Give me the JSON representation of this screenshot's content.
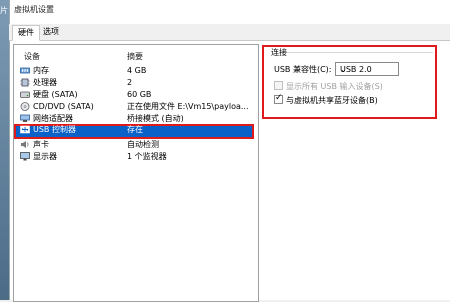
{
  "desktop_fragment": "片",
  "window": {
    "title": "虚拟机设置"
  },
  "tabs": [
    {
      "label": "硬件"
    },
    {
      "label": "选项"
    }
  ],
  "device_table": {
    "headers": {
      "device": "设备",
      "summary": "摘要"
    },
    "rows": [
      {
        "label": "内存",
        "value": "4 GB",
        "icon": "memory-icon"
      },
      {
        "label": "处理器",
        "value": "2",
        "icon": "processor-icon"
      },
      {
        "label": "硬盘 (SATA)",
        "value": "60 GB",
        "icon": "hard-disk-icon"
      },
      {
        "label": "CD/DVD (SATA)",
        "value": "正在使用文件 E:\\Vm15\\payloa...",
        "icon": "cd-dvd-icon"
      },
      {
        "label": "网络适配器",
        "value": "桥接模式 (自动)",
        "icon": "network-adapter-icon"
      },
      {
        "label": "USB 控制器",
        "value": "存在",
        "icon": "usb-controller-icon",
        "selected": true
      },
      {
        "label": "声卡",
        "value": "自动检测",
        "icon": "sound-card-icon"
      },
      {
        "label": "显示器",
        "value": "1 个监视器",
        "icon": "display-icon"
      }
    ]
  },
  "connection": {
    "group_title": "连接",
    "compat_label": "USB 兼容性(C):",
    "compat_value": "USB 2.0",
    "show_all_input": {
      "label": "显示所有 USB 输入设备(S)",
      "checked": false,
      "disabled": true
    },
    "share_bt": {
      "label": "与虚拟机共享蓝牙设备(B)",
      "checked": true,
      "disabled": false
    }
  },
  "colors": {
    "selection": "#0a62c9",
    "highlight_border": "#e0191b"
  }
}
